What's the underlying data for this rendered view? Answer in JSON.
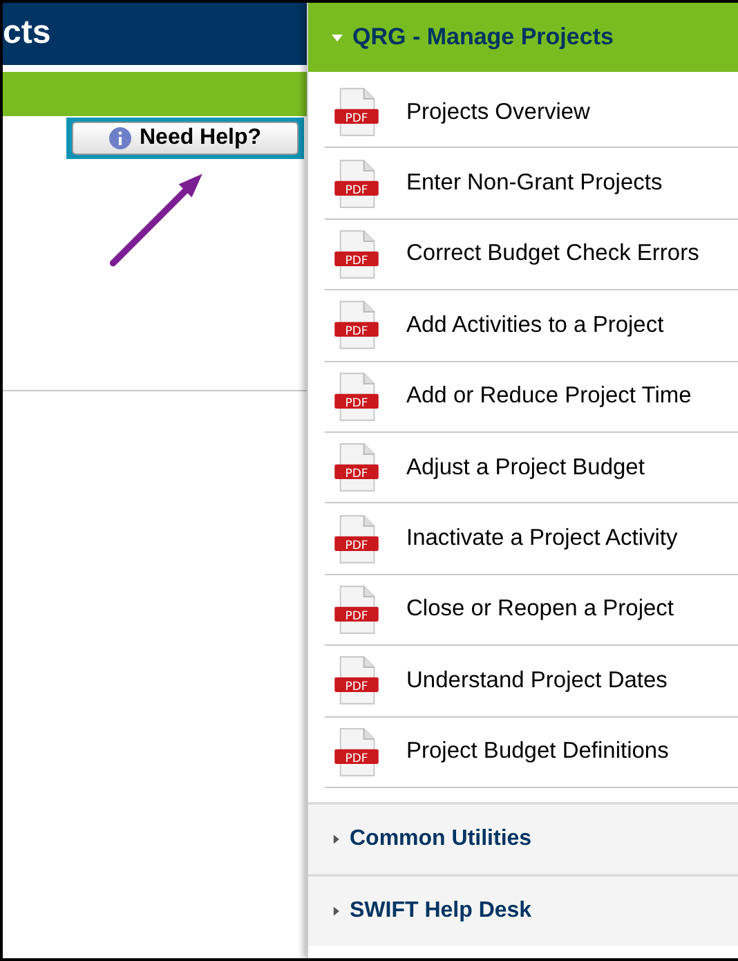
{
  "left_header": {
    "title": "cts"
  },
  "help_button": {
    "label": "Need Help?"
  },
  "sections": [
    {
      "title": "QRG - Manage Projects",
      "expanded": true,
      "items": [
        {
          "icon_text": "PDF",
          "label": "Projects Overview"
        },
        {
          "icon_text": "PDF",
          "label": "Enter Non-Grant Projects"
        },
        {
          "icon_text": "PDF",
          "label": "Correct Budget Check Errors"
        },
        {
          "icon_text": "PDF",
          "label": "Add Activities to a Project"
        },
        {
          "icon_text": "PDF",
          "label": "Add or Reduce Project Time"
        },
        {
          "icon_text": "PDF",
          "label": "Adjust a Project Budget"
        },
        {
          "icon_text": "PDF",
          "label": "Inactivate a Project Activity"
        },
        {
          "icon_text": "PDF",
          "label": "Close or Reopen a Project"
        },
        {
          "icon_text": "PDF",
          "label": "Understand Project Dates"
        },
        {
          "icon_text": "PDF",
          "label": "Project Budget Definitions"
        }
      ]
    },
    {
      "title": "Common Utilities",
      "expanded": false
    },
    {
      "title": "SWIFT Help Desk",
      "expanded": false
    }
  ]
}
